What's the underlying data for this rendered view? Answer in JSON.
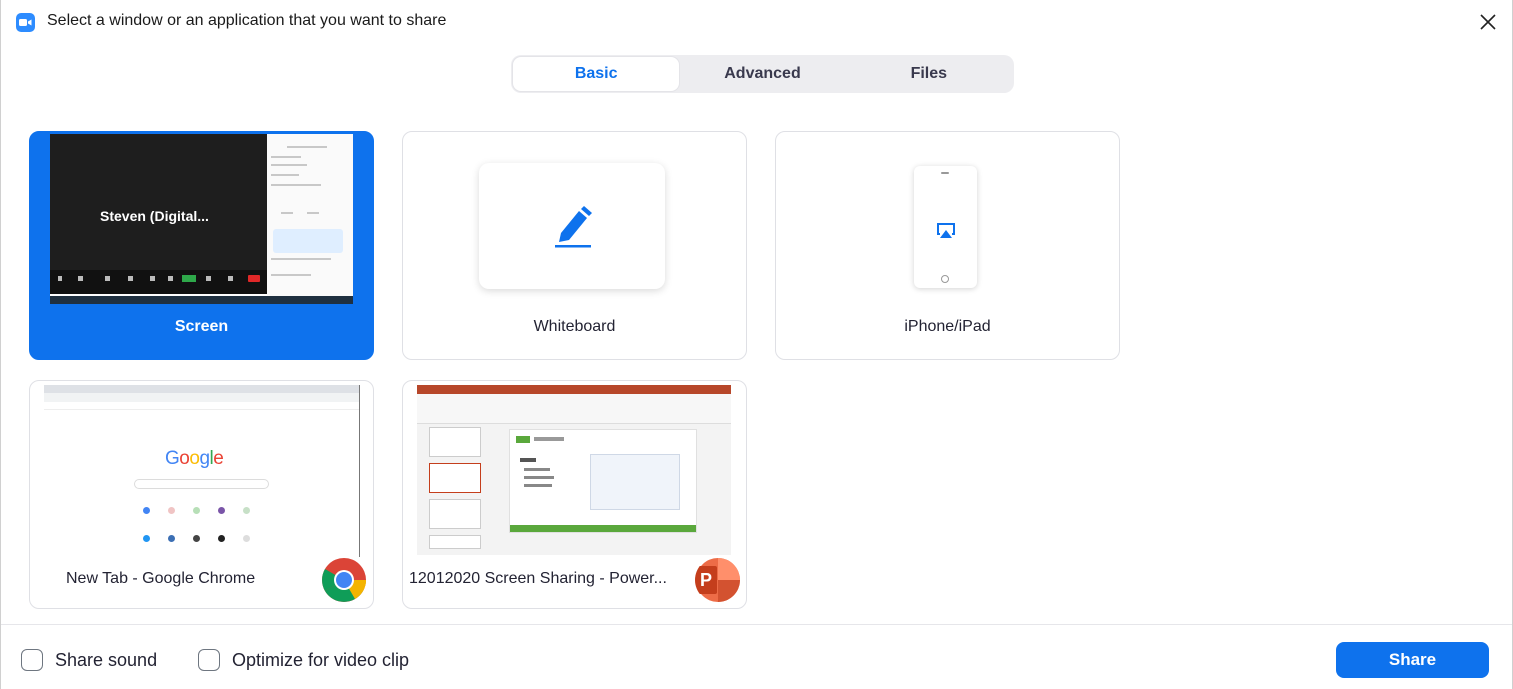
{
  "dialog": {
    "title": "Select a window or an application that you want to share",
    "app_icon": "zoom-camera-icon",
    "close_icon": "close-icon"
  },
  "tabs": [
    {
      "label": "Basic",
      "active": true
    },
    {
      "label": "Advanced",
      "active": false
    },
    {
      "label": "Files",
      "active": false
    }
  ],
  "options": [
    {
      "label": "Screen",
      "selected": true,
      "thumbnail_text": "Steven  (Digital..."
    },
    {
      "label": "Whiteboard",
      "selected": false,
      "icon": "pen-icon"
    },
    {
      "label": "iPhone/iPad",
      "selected": false,
      "icon": "airplay-icon"
    },
    {
      "label": "New Tab - Google Chrome",
      "selected": false,
      "badge_icon": "chrome-icon",
      "thumbnail_text": "Google"
    },
    {
      "label": "12012020 Screen Sharing - Power...",
      "selected": false,
      "badge_icon": "powerpoint-icon",
      "badge_letter": "P"
    }
  ],
  "footer": {
    "share_sound": {
      "label": "Share sound",
      "checked": false
    },
    "optimize_video": {
      "label": "Optimize for video clip",
      "checked": false
    },
    "share_button": "Share"
  },
  "colors": {
    "accent": "#0e72ed",
    "tab_background": "#ededf0",
    "card_border": "#dfe0e5"
  }
}
